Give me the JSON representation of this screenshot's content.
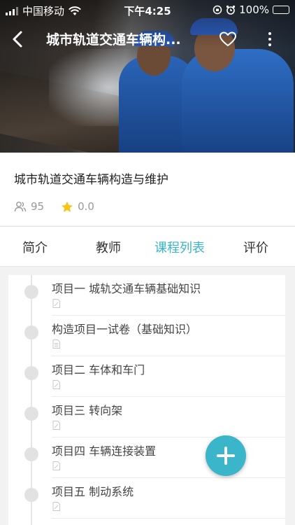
{
  "status_bar": {
    "carrier": "中国移动",
    "time": "下午4:25",
    "battery": "100%"
  },
  "nav": {
    "title": "城市轨道交通车辆构..."
  },
  "course": {
    "title": "城市轨道交通车辆构造与维护",
    "learners": "95",
    "rating": "0.0"
  },
  "tabs": [
    {
      "label": "简介"
    },
    {
      "label": "教师"
    },
    {
      "label": "课程列表"
    },
    {
      "label": "评价"
    }
  ],
  "course_list": [
    {
      "label": "项目一  城轨交通车辆基础知识",
      "type": "edit-doc-icon"
    },
    {
      "label": "构造项目一试卷（基础知识）",
      "type": "doc-icon"
    },
    {
      "label": "项目二 车体和车门",
      "type": "edit-doc-icon"
    },
    {
      "label": "项目三 转向架",
      "type": "edit-doc-icon"
    },
    {
      "label": "项目四 车辆连接装置",
      "type": "edit-doc-icon"
    },
    {
      "label": "项目五 制动系统",
      "type": "edit-doc-icon"
    }
  ],
  "colors": {
    "accent": "#3ab5c9",
    "battery": "#4cd964"
  }
}
